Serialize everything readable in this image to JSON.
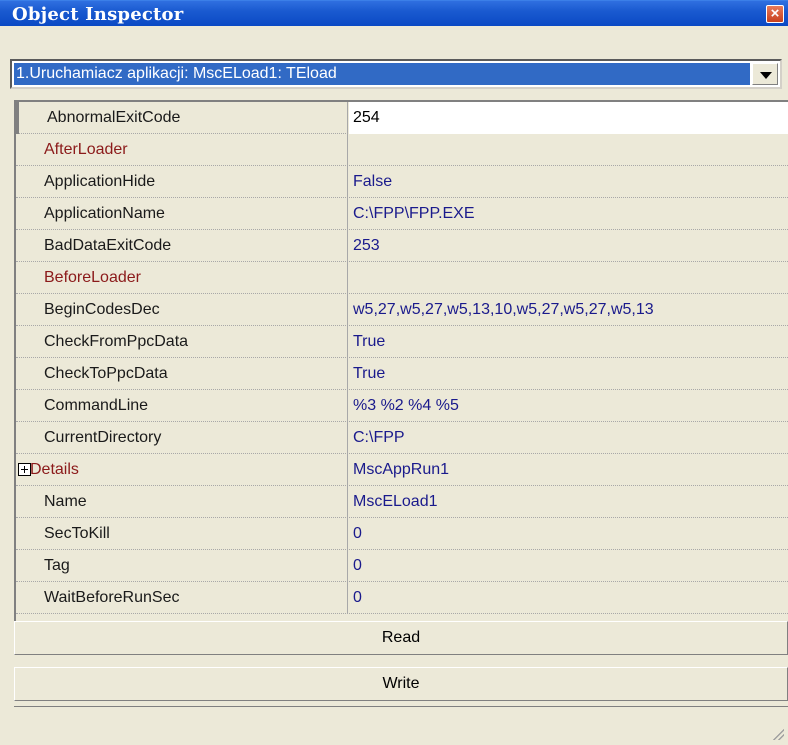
{
  "window": {
    "title": "Object Inspector"
  },
  "component_selector": {
    "selected": "1.Uruchamiacz aplikacji: MscELoad1: TEload"
  },
  "properties": [
    {
      "name": "AbnormalExitCode",
      "value": "254",
      "kind": "property",
      "selected": true
    },
    {
      "name": "AfterLoader",
      "value": "",
      "kind": "event"
    },
    {
      "name": "ApplicationHide",
      "value": "False",
      "kind": "property"
    },
    {
      "name": "ApplicationName",
      "value": "C:\\FPP\\FPP.EXE",
      "kind": "property"
    },
    {
      "name": "BadDataExitCode",
      "value": "253",
      "kind": "property"
    },
    {
      "name": "BeforeLoader",
      "value": "",
      "kind": "event"
    },
    {
      "name": "BeginCodesDec",
      "value": "w5,27,w5,27,w5,13,10,w5,27,w5,27,w5,13",
      "kind": "property"
    },
    {
      "name": "CheckFromPpcData",
      "value": "True",
      "kind": "property"
    },
    {
      "name": "CheckToPpcData",
      "value": "True",
      "kind": "property"
    },
    {
      "name": "CommandLine",
      "value": "%3 %2 %4 %5",
      "kind": "property"
    },
    {
      "name": "CurrentDirectory",
      "value": "C:\\FPP",
      "kind": "property"
    },
    {
      "name": "Details",
      "value": "MscAppRun1",
      "kind": "event",
      "expandable": true
    },
    {
      "name": "Name",
      "value": "MscELoad1",
      "kind": "property"
    },
    {
      "name": "SecToKill",
      "value": "0",
      "kind": "property"
    },
    {
      "name": "Tag",
      "value": "0",
      "kind": "property"
    },
    {
      "name": "WaitBeforeRunSec",
      "value": "0",
      "kind": "property"
    }
  ],
  "buttons": {
    "read": "Read",
    "write": "Write"
  },
  "colors": {
    "title_bar": "#0a49c4",
    "event_name": "#8b1a1a",
    "value_text": "#1a1a8c",
    "selection": "#316ac5"
  },
  "icons": {
    "close": "close-icon",
    "dropdown": "chevron-down-icon",
    "expand": "plus-box-icon",
    "grip": "resize-grip-icon"
  }
}
